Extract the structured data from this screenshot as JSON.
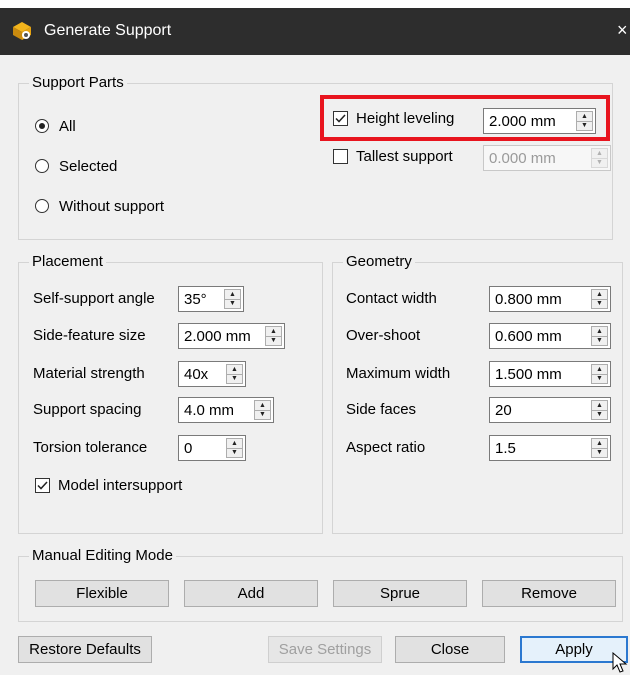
{
  "window": {
    "title": "Generate Support",
    "close_glyph": "×"
  },
  "support_parts": {
    "title": "Support Parts",
    "options": [
      {
        "label": "All",
        "checked": true
      },
      {
        "label": "Selected",
        "checked": false
      },
      {
        "label": "Without support",
        "checked": false
      }
    ],
    "height_leveling": {
      "label": "Height leveling",
      "checked": true,
      "value": "2.000 mm"
    },
    "tallest_support": {
      "label": "Tallest support",
      "checked": false,
      "value": "0.000 mm",
      "disabled": true
    }
  },
  "placement": {
    "title": "Placement",
    "fields": [
      {
        "label": "Self-support angle",
        "value": "35°"
      },
      {
        "label": "Side-feature size",
        "value": "2.000 mm"
      },
      {
        "label": "Material strength",
        "value": "40x"
      },
      {
        "label": "Support spacing",
        "value": "4.0 mm"
      },
      {
        "label": "Torsion tolerance",
        "value": "0"
      }
    ],
    "model_intersupport": {
      "label": "Model intersupport",
      "checked": true
    }
  },
  "geometry": {
    "title": "Geometry",
    "fields": [
      {
        "label": "Contact width",
        "value": "0.800 mm"
      },
      {
        "label": "Over-shoot",
        "value": "0.600 mm"
      },
      {
        "label": "Maximum width",
        "value": "1.500 mm"
      },
      {
        "label": "Side faces",
        "value": "20"
      },
      {
        "label": "Aspect ratio",
        "value": "1.5"
      }
    ]
  },
  "manual_editing": {
    "title": "Manual Editing Mode",
    "buttons": [
      "Flexible",
      "Add",
      "Sprue",
      "Remove"
    ]
  },
  "footer": {
    "restore_defaults": "Restore Defaults",
    "save_settings": "Save Settings",
    "close": "Close",
    "apply": "Apply"
  },
  "colors": {
    "titlebar": "#2d2d2d",
    "dialog_bg": "#f0f0f0",
    "highlight": "#e8141e",
    "default_button_border": "#2b78d0"
  },
  "icons": [
    "app-icon",
    "close-icon",
    "mouse-cursor-icon"
  ]
}
